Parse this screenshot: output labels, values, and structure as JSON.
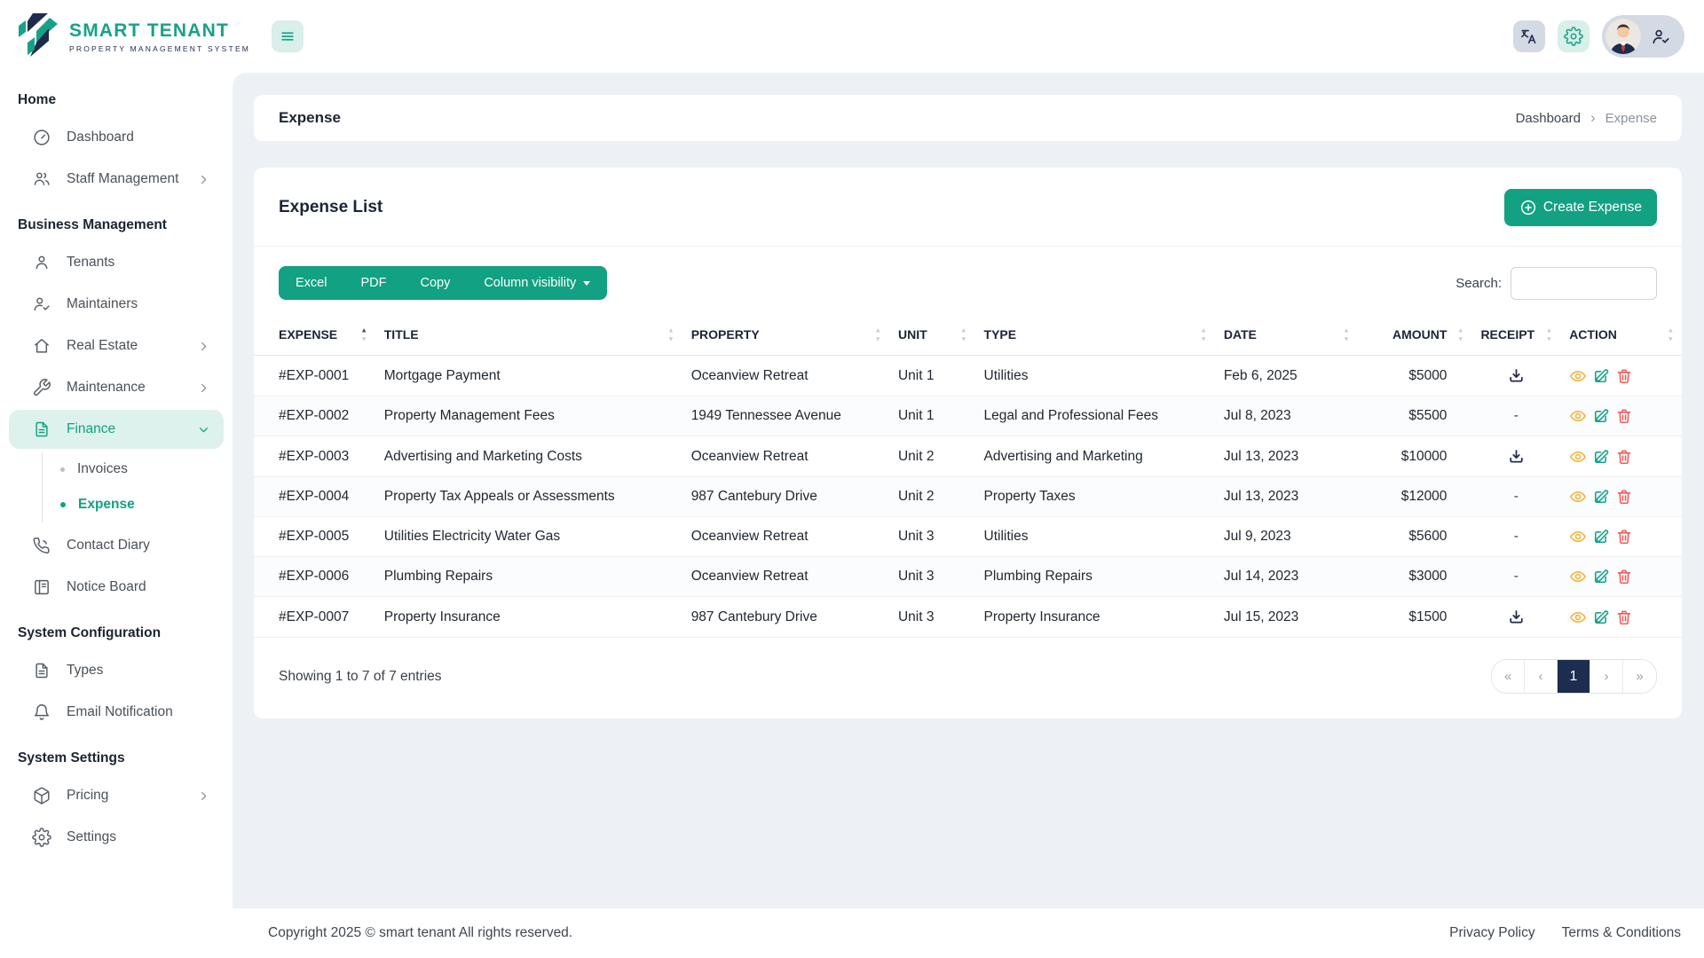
{
  "brand": {
    "name": "SMART TENANT",
    "tagline": "PROPERTY MANAGEMENT SYSTEM"
  },
  "icons": {
    "sort_asc": "▲",
    "sort_desc": "▼"
  },
  "sidebar": {
    "sections": [
      {
        "label": "Home",
        "items": [
          {
            "label": "Dashboard",
            "icon": "dashboard-icon"
          },
          {
            "label": "Staff Management",
            "icon": "staff-icon",
            "has_submenu": true
          }
        ]
      },
      {
        "label": "Business Management",
        "items": [
          {
            "label": "Tenants",
            "icon": "person-icon"
          },
          {
            "label": "Maintainers",
            "icon": "person-check-icon"
          },
          {
            "label": "Real Estate",
            "icon": "home-icon",
            "has_submenu": true
          },
          {
            "label": "Maintenance",
            "icon": "wrench-icon",
            "has_submenu": true
          },
          {
            "label": "Finance",
            "icon": "file-icon",
            "active": true,
            "expanded": true,
            "children": [
              {
                "label": "Invoices",
                "active": false
              },
              {
                "label": "Expense",
                "active": true
              }
            ]
          },
          {
            "label": "Contact Diary",
            "icon": "phone-icon"
          },
          {
            "label": "Notice Board",
            "icon": "board-icon"
          }
        ]
      },
      {
        "label": "System Configuration",
        "items": [
          {
            "label": "Types",
            "icon": "file-icon"
          },
          {
            "label": "Email Notification",
            "icon": "bell-icon"
          }
        ]
      },
      {
        "label": "System Settings",
        "items": [
          {
            "label": "Pricing",
            "icon": "package-icon",
            "has_submenu": true
          },
          {
            "label": "Settings",
            "icon": "gear-icon"
          }
        ]
      }
    ]
  },
  "breadcrumb": {
    "page_title": "Expense",
    "trail": [
      "Dashboard",
      "Expense"
    ]
  },
  "panel": {
    "title": "Expense List",
    "create_button": "Create Expense",
    "export_buttons": [
      "Excel",
      "PDF",
      "Copy"
    ],
    "column_visibility": "Column visibility",
    "search_label": "Search:",
    "search_value": ""
  },
  "table": {
    "columns": [
      "EXPENSE",
      "TITLE",
      "PROPERTY",
      "UNIT",
      "TYPE",
      "DATE",
      "AMOUNT",
      "RECEIPT",
      "ACTION"
    ],
    "sort": {
      "column": "EXPENSE",
      "direction": "asc"
    },
    "rows": [
      {
        "expense": "#EXP-0001",
        "title": "Mortgage Payment",
        "property": "Oceanview Retreat",
        "unit": "Unit 1",
        "type": "Utilities",
        "date": "Feb 6, 2025",
        "amount": "$5000",
        "receipt": "download"
      },
      {
        "expense": "#EXP-0002",
        "title": "Property Management Fees",
        "property": "1949 Tennessee Avenue",
        "unit": "Unit 1",
        "type": "Legal and Professional Fees",
        "date": "Jul 8, 2023",
        "amount": "$5500",
        "receipt": "-"
      },
      {
        "expense": "#EXP-0003",
        "title": "Advertising and Marketing Costs",
        "property": "Oceanview Retreat",
        "unit": "Unit 2",
        "type": "Advertising and Marketing",
        "date": "Jul 13, 2023",
        "amount": "$10000",
        "receipt": "download"
      },
      {
        "expense": "#EXP-0004",
        "title": "Property Tax Appeals or Assessments",
        "property": "987 Cantebury Drive",
        "unit": "Unit 2",
        "type": "Property Taxes",
        "date": "Jul 13, 2023",
        "amount": "$12000",
        "receipt": "-"
      },
      {
        "expense": "#EXP-0005",
        "title": "Utilities Electricity Water Gas",
        "property": "Oceanview Retreat",
        "unit": "Unit 3",
        "type": "Utilities",
        "date": "Jul 9, 2023",
        "amount": "$5600",
        "receipt": "-"
      },
      {
        "expense": "#EXP-0006",
        "title": "Plumbing Repairs",
        "property": "Oceanview Retreat",
        "unit": "Unit 3",
        "type": "Plumbing Repairs",
        "date": "Jul 14, 2023",
        "amount": "$3000",
        "receipt": "-"
      },
      {
        "expense": "#EXP-0007",
        "title": "Property Insurance",
        "property": "987 Cantebury Drive",
        "unit": "Unit 3",
        "type": "Property Insurance",
        "date": "Jul 15, 2023",
        "amount": "$1500",
        "receipt": "download"
      }
    ],
    "summary": "Showing 1 to 7 of 7 entries",
    "pagination": {
      "first": "«",
      "prev": "‹",
      "page": "1",
      "next": "›",
      "last": "»"
    }
  },
  "footer": {
    "copyright": "Copyright 2025 © smart tenant All rights reserved.",
    "links": [
      "Privacy Policy",
      "Terms & Conditions"
    ]
  },
  "colors": {
    "brand_teal": "#17a287",
    "button_teal": "#12a182",
    "navy": "#1e2c4c",
    "active_bg": "#ddf2ec",
    "page_bg": "#edf1f6",
    "view_icon": "#f0b644",
    "edit_icon": "#17a287",
    "delete_icon": "#f15b5b"
  }
}
